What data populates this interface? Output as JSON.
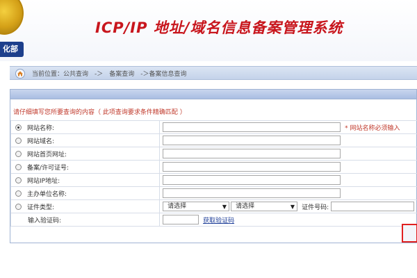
{
  "banner": {
    "ministry_tail": "化部",
    "system_title": "ICP/IP 地址/域名信息备案管理系统"
  },
  "breadcrumb": {
    "text": "当前位置：公共查询　-＞　备案查询　-＞备案信息查询"
  },
  "form": {
    "instruction": "请仔细填写您所要查询的内容（ 此项查询要求条件精确匹配 ）",
    "rows": [
      {
        "label": "网站名称:",
        "selected": true
      },
      {
        "label": "网站域名:",
        "selected": false
      },
      {
        "label": "网站首页网址:",
        "selected": false
      },
      {
        "label": "备案/许可证号:",
        "selected": false
      },
      {
        "label": "网站IP地址:",
        "selected": false
      },
      {
        "label": "主办单位名称:",
        "selected": false
      },
      {
        "label": "证件类型:",
        "selected": false
      }
    ],
    "required_note": "* 网站名称必须输入",
    "cert_type_select_1": "请选择",
    "cert_type_select_2": "请选择",
    "cert_no_label": "证件号码:",
    "captcha_label": "输入验证码:",
    "captcha_link": "获取验证码"
  },
  "colors": {
    "title_red": "#c8161d",
    "ministry_blue": "#1d3f8c",
    "panel_border": "#9fb3d3",
    "highlight_box": "#e02020"
  },
  "icons": {
    "home": "home-icon",
    "emblem": "national-emblem-icon"
  }
}
